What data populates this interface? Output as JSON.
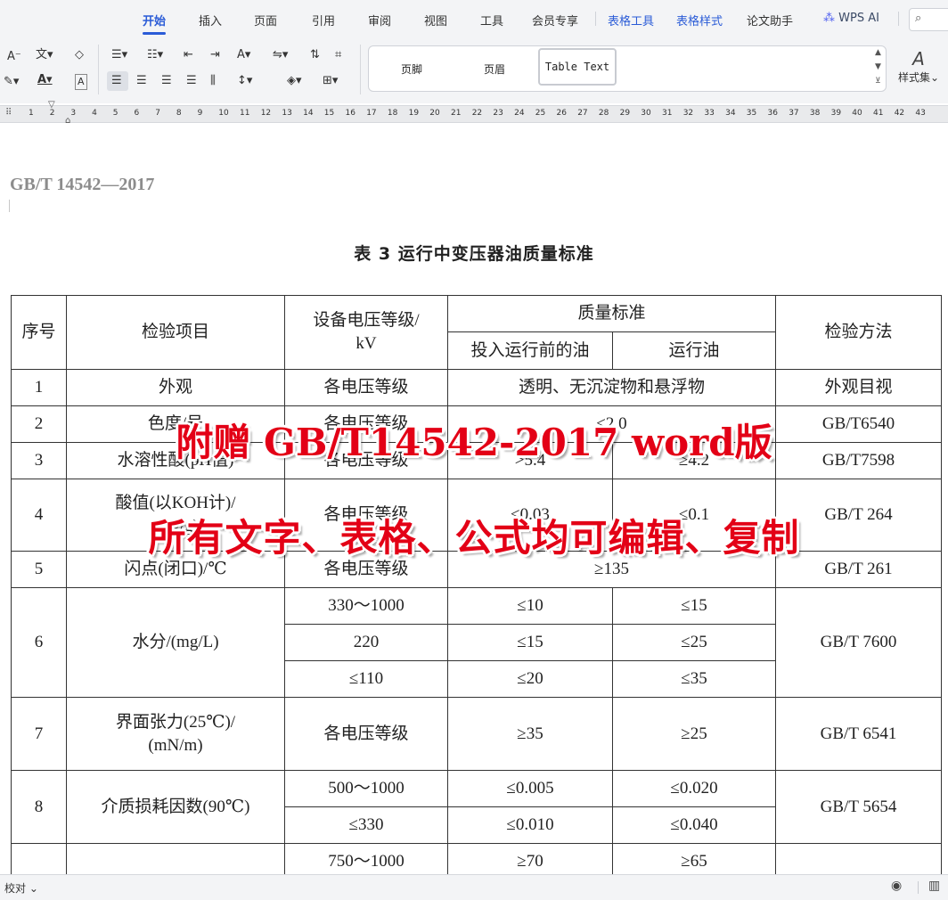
{
  "menu": {
    "tabs": [
      "开始",
      "插入",
      "页面",
      "引用",
      "审阅",
      "视图",
      "工具",
      "会员专享",
      "表格工具",
      "表格样式",
      "论文助手",
      "WPS AI"
    ],
    "active": "开始"
  },
  "ribbon": {
    "styles": [
      "页脚",
      "页眉",
      "Table Text"
    ],
    "style_set_label": "样式集"
  },
  "ruler": {
    "numbers": [
      "1",
      "2",
      "3",
      "4",
      "5",
      "6",
      "7",
      "8",
      "9",
      "10",
      "11",
      "12",
      "13",
      "14",
      "15",
      "16",
      "17",
      "18",
      "19",
      "20",
      "21",
      "22",
      "23",
      "24",
      "25",
      "26",
      "27",
      "28",
      "29",
      "30",
      "31",
      "32",
      "33",
      "34",
      "35",
      "36",
      "37",
      "38",
      "39",
      "40",
      "41",
      "42",
      "43"
    ]
  },
  "document": {
    "header": "GB/T 14542—2017",
    "table_caption": "表 3  运行中变压器油质量标准",
    "table": {
      "head": {
        "no": "序号",
        "item": "检验项目",
        "voltage": "设备电压等级/",
        "voltage_unit": "kV",
        "quality": "质量标准",
        "before": "投入运行前的油",
        "running": "运行油",
        "method": "检验方法"
      },
      "rows": {
        "r1": {
          "no": "1",
          "item": "外观",
          "voltage": "各电压等级",
          "quality": "透明、无沉淀物和悬浮物",
          "method": "外观目视"
        },
        "r2": {
          "no": "2",
          "item": "色度/号",
          "voltage": "各电压等级",
          "quality": "≤2.0",
          "method": "GB/T6540"
        },
        "r3": {
          "no": "3",
          "item": "水溶性酸(pH值)",
          "voltage": "各电压等级",
          "before": ">5.4",
          "running": "≥4.2",
          "method": "GB/T7598"
        },
        "r4": {
          "no": "4",
          "item": "酸值(以KOH计)/",
          "item2": "(mg/g)",
          "voltage": "各电压等级",
          "before": "≤0.03",
          "running": "≤0.1",
          "method": "GB/T 264"
        },
        "r5": {
          "no": "5",
          "item": "闪点(闭口)/℃",
          "voltage": "各电压等级",
          "quality": "≥135",
          "method": "GB/T  261"
        },
        "r6": {
          "no": "6",
          "item": "水分/(mg/L)",
          "method": "GB/T 7600",
          "sub": [
            {
              "voltage": "330～1000",
              "before": "≤10",
              "running": "≤15"
            },
            {
              "voltage": "220",
              "before": "≤15",
              "running": "≤25"
            },
            {
              "voltage": "≤110",
              "before": "≤20",
              "running": "≤35"
            }
          ]
        },
        "r7": {
          "no": "7",
          "item": "界面张力(25℃)/",
          "item2": "(mN/m)",
          "voltage": "各电压等级",
          "before": "≥35",
          "running": "≥25",
          "method": "GB/T 6541"
        },
        "r8": {
          "no": "8",
          "item": "介质损耗因数(90℃)",
          "method": "GB/T 5654",
          "sub": [
            {
              "voltage": "500～1000",
              "before": "≤0.005",
              "running": "≤0.020"
            },
            {
              "voltage": "≤330",
              "before": "≤0.010",
              "running": "≤0.040"
            }
          ]
        },
        "r9": {
          "voltage": "750～1000",
          "before": "≥70",
          "running": "≥65"
        }
      }
    }
  },
  "overlay": {
    "line1": "附赠 GB/T14542-2017 word版",
    "line2": "所有文字、表格、公式均可编辑、复制"
  },
  "status": {
    "proofread": "校对 ⌄"
  }
}
